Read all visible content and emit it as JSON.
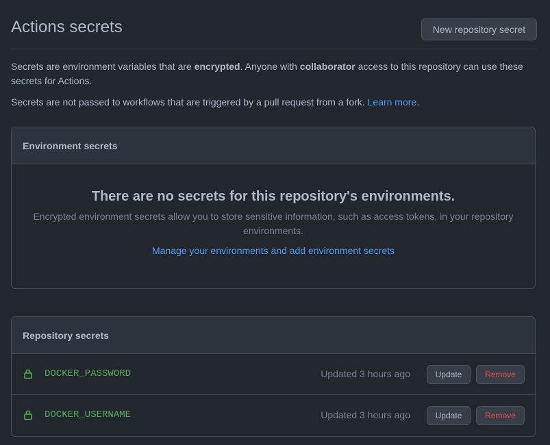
{
  "header": {
    "title": "Actions secrets",
    "new_button": "New repository secret"
  },
  "description": {
    "p1_part1": "Secrets are environment variables that are ",
    "p1_bold1": "encrypted",
    "p1_part2": ". Anyone with ",
    "p1_bold2": "collaborator",
    "p1_part3": " access to this repository can use these secrets for Actions.",
    "p2_text": "Secrets are not passed to workflows that are triggered by a pull request from a fork. ",
    "p2_link": "Learn more",
    "p2_end": "."
  },
  "environment": {
    "heading": "Environment secrets",
    "blank_title": "There are no secrets for this repository's environments.",
    "blank_text": "Encrypted environment secrets allow you to store sensitive information, such as access tokens, in your repository environments.",
    "manage_link": "Manage your environments and add environment secrets"
  },
  "repository": {
    "heading": "Repository secrets",
    "secrets": [
      {
        "name": "DOCKER_PASSWORD",
        "updated": "Updated 3 hours ago",
        "update_label": "Update",
        "remove_label": "Remove"
      },
      {
        "name": "DOCKER_USERNAME",
        "updated": "Updated 3 hours ago",
        "update_label": "Update",
        "remove_label": "Remove"
      }
    ]
  },
  "icons": {
    "secret": "lock-icon"
  },
  "colors": {
    "background": "#22272e",
    "secret_name": "#57ab5a",
    "link": "#539bf5",
    "danger": "#e5534b"
  }
}
